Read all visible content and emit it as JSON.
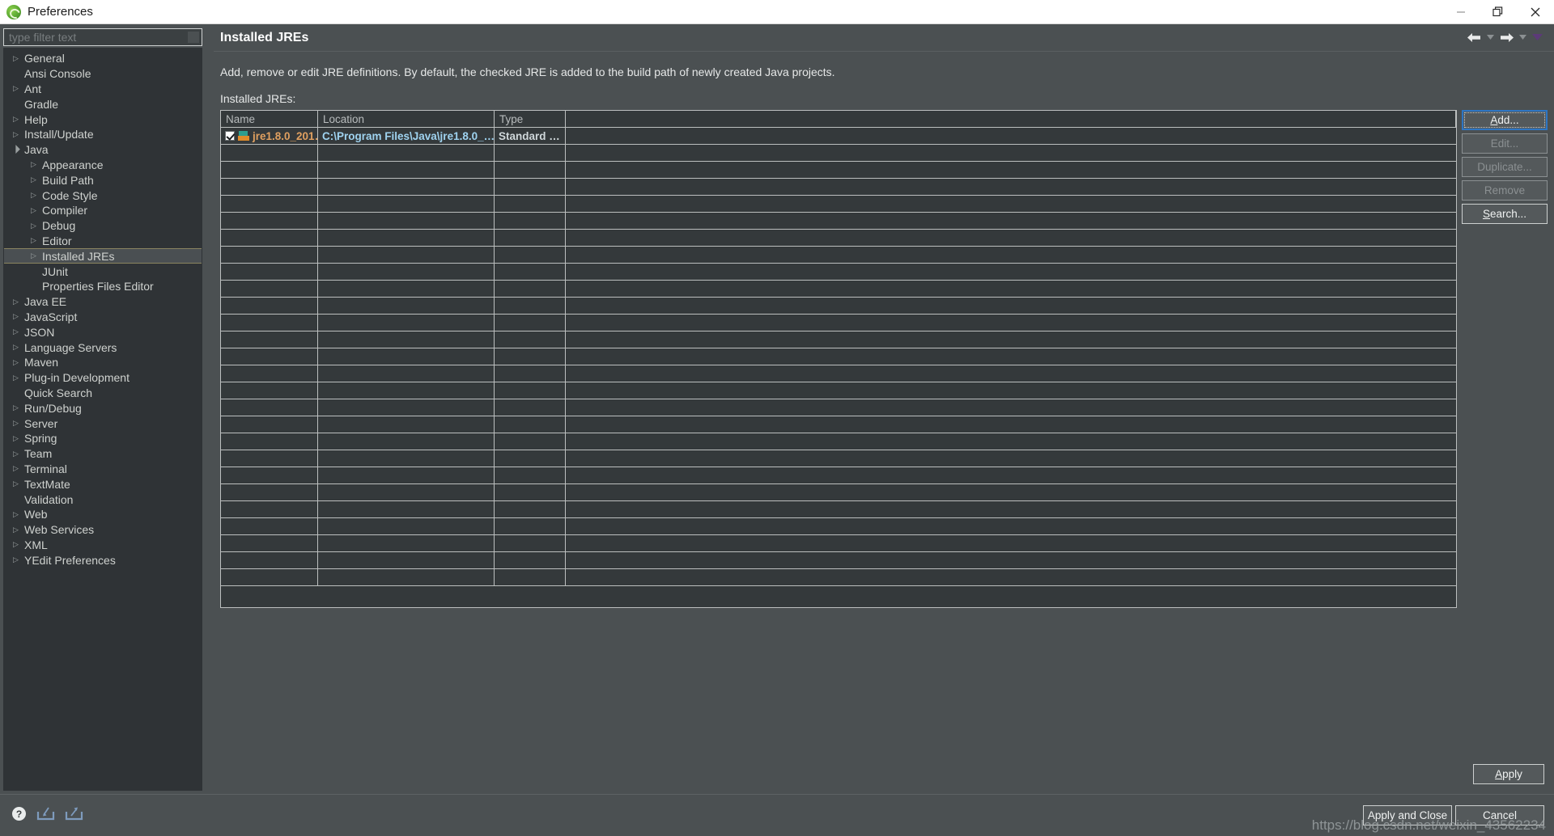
{
  "window": {
    "title": "Preferences",
    "icon": "eclipse-icon",
    "controls": {
      "minimize": "minimize-icon",
      "restore": "restore-icon",
      "close": "close-icon"
    }
  },
  "filter": {
    "placeholder": "type filter text",
    "value": ""
  },
  "tree": {
    "items": [
      {
        "label": "General",
        "depth": 0,
        "arrow": "collapsed",
        "selected": false
      },
      {
        "label": "Ansi Console",
        "depth": 0,
        "arrow": "none",
        "selected": false
      },
      {
        "label": "Ant",
        "depth": 0,
        "arrow": "collapsed",
        "selected": false
      },
      {
        "label": "Gradle",
        "depth": 0,
        "arrow": "none",
        "selected": false
      },
      {
        "label": "Help",
        "depth": 0,
        "arrow": "collapsed",
        "selected": false
      },
      {
        "label": "Install/Update",
        "depth": 0,
        "arrow": "collapsed",
        "selected": false
      },
      {
        "label": "Java",
        "depth": 0,
        "arrow": "expanded",
        "selected": false
      },
      {
        "label": "Appearance",
        "depth": 1,
        "arrow": "collapsed",
        "selected": false
      },
      {
        "label": "Build Path",
        "depth": 1,
        "arrow": "collapsed",
        "selected": false
      },
      {
        "label": "Code Style",
        "depth": 1,
        "arrow": "collapsed",
        "selected": false
      },
      {
        "label": "Compiler",
        "depth": 1,
        "arrow": "collapsed",
        "selected": false
      },
      {
        "label": "Debug",
        "depth": 1,
        "arrow": "collapsed",
        "selected": false
      },
      {
        "label": "Editor",
        "depth": 1,
        "arrow": "collapsed",
        "selected": false
      },
      {
        "label": "Installed JREs",
        "depth": 1,
        "arrow": "collapsed",
        "selected": true
      },
      {
        "label": "JUnit",
        "depth": 1,
        "arrow": "none",
        "selected": false
      },
      {
        "label": "Properties Files Editor",
        "depth": 1,
        "arrow": "none",
        "selected": false
      },
      {
        "label": "Java EE",
        "depth": 0,
        "arrow": "collapsed",
        "selected": false
      },
      {
        "label": "JavaScript",
        "depth": 0,
        "arrow": "collapsed",
        "selected": false
      },
      {
        "label": "JSON",
        "depth": 0,
        "arrow": "collapsed",
        "selected": false
      },
      {
        "label": "Language Servers",
        "depth": 0,
        "arrow": "collapsed",
        "selected": false
      },
      {
        "label": "Maven",
        "depth": 0,
        "arrow": "collapsed",
        "selected": false
      },
      {
        "label": "Plug-in Development",
        "depth": 0,
        "arrow": "collapsed",
        "selected": false
      },
      {
        "label": "Quick Search",
        "depth": 0,
        "arrow": "none",
        "selected": false
      },
      {
        "label": "Run/Debug",
        "depth": 0,
        "arrow": "collapsed",
        "selected": false
      },
      {
        "label": "Server",
        "depth": 0,
        "arrow": "collapsed",
        "selected": false
      },
      {
        "label": "Spring",
        "depth": 0,
        "arrow": "collapsed",
        "selected": false
      },
      {
        "label": "Team",
        "depth": 0,
        "arrow": "collapsed",
        "selected": false
      },
      {
        "label": "Terminal",
        "depth": 0,
        "arrow": "collapsed",
        "selected": false
      },
      {
        "label": "TextMate",
        "depth": 0,
        "arrow": "collapsed",
        "selected": false
      },
      {
        "label": "Validation",
        "depth": 0,
        "arrow": "none",
        "selected": false
      },
      {
        "label": "Web",
        "depth": 0,
        "arrow": "collapsed",
        "selected": false
      },
      {
        "label": "Web Services",
        "depth": 0,
        "arrow": "collapsed",
        "selected": false
      },
      {
        "label": "XML",
        "depth": 0,
        "arrow": "collapsed",
        "selected": false
      },
      {
        "label": "YEdit Preferences",
        "depth": 0,
        "arrow": "collapsed",
        "selected": false
      }
    ]
  },
  "page": {
    "title": "Installed JREs",
    "description": "Add, remove or edit JRE definitions. By default, the checked JRE is added to the build path of newly created Java projects.",
    "list_label": "Installed JREs:",
    "nav": {
      "back": "back-arrow-icon",
      "back_menu": "chevron-down-icon",
      "forward": "forward-arrow-icon",
      "forward_menu": "chevron-down-icon",
      "view_menu": "view-menu-icon"
    }
  },
  "table": {
    "columns": [
      "Name",
      "Location",
      "Type"
    ],
    "rows": [
      {
        "checked": true,
        "icon": "jre-icon",
        "name": "jre1.8.0_201…",
        "location": "C:\\Program Files\\Java\\jre1.8.0_…",
        "type": "Standard …"
      }
    ],
    "empty_row_count": 26
  },
  "side_buttons": [
    {
      "label": "Add...",
      "accel": "A",
      "state": "focused"
    },
    {
      "label": "Edit...",
      "accel": "",
      "state": "disabled"
    },
    {
      "label": "Duplicate...",
      "accel": "",
      "state": "disabled"
    },
    {
      "label": "Remove",
      "accel": "",
      "state": "disabled"
    },
    {
      "label": "Search...",
      "accel": "S",
      "state": "enabled"
    }
  ],
  "apply_button": {
    "label": "Apply",
    "accel": "A"
  },
  "footer": {
    "icons": [
      "help-icon",
      "import-icon",
      "export-icon"
    ],
    "buttons": [
      {
        "label": "Apply and Close"
      },
      {
        "label": "Cancel"
      }
    ],
    "watermark": "https://blog.csdn.net/weixin_43562234"
  }
}
